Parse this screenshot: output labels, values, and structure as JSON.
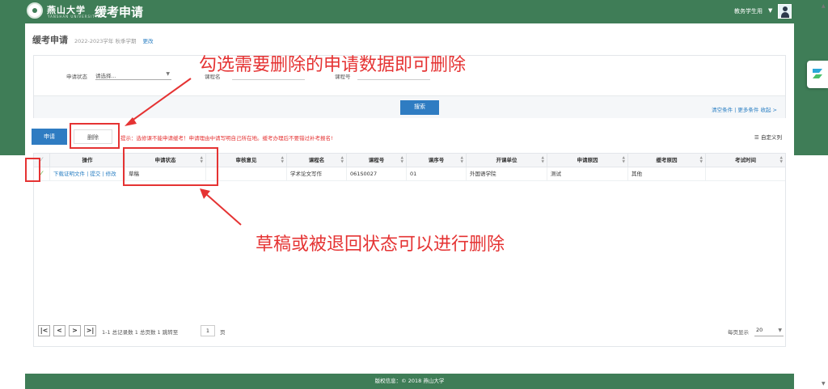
{
  "header": {
    "university_name": "燕山大学",
    "university_sub": "YANSHAN UNIVERSITY",
    "app_title": "缓考申请",
    "user_name": "教务学生用"
  },
  "page": {
    "title": "缓考申请",
    "term": "2022-2023学年 秋季学期",
    "change_link": "更改"
  },
  "filters": {
    "status_label": "申请状态",
    "status_value": "请选择...",
    "course_name_label": "课程名",
    "course_code_label": "课程号",
    "search_button": "搜索",
    "links": "清空条件 | 更多条件  收起 >"
  },
  "toolbar": {
    "apply_button": "申请",
    "delete_button": "删除",
    "notice": "提示：选修课不能申请缓考！申请理由中请写明自己所在地。缓考办理后不要错过补考报名!",
    "custom_columns": "自定义列"
  },
  "table": {
    "columns": [
      "操作",
      "申请状态",
      "审核意见",
      "课程名",
      "课程号",
      "课序号",
      "开课单位",
      "申请原因",
      "缓考原因",
      "考试时间"
    ],
    "rows": [
      {
        "actions": "下载证明文件 | 提交 | 修改",
        "status": "草稿",
        "review": "",
        "course_name": "学术论文写作",
        "course_code": "061S0027",
        "section": "01",
        "dept": "外国语学院",
        "apply_reason": "测试",
        "defer_reason": "其他",
        "exam_time": ""
      }
    ]
  },
  "pager": {
    "summary": "1-1 总记录数 1   总页数 1   跳转至",
    "page_value": "1",
    "page_unit": "页",
    "per_page_label": "每页显示",
    "per_page_value": "20"
  },
  "footer": {
    "text": "版权信息：© 2018 燕山大学"
  },
  "annotations": {
    "top_text": "勾选需要删除的申请数据即可删除",
    "bottom_text": "草稿或被退回状态可以进行删除",
    "color": "#e53333"
  },
  "colors": {
    "brand_green": "#3f7d57",
    "primary_blue": "#2f7cc2",
    "alert_red": "#e53333"
  }
}
